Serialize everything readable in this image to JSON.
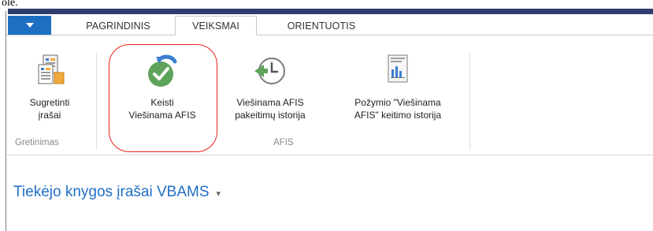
{
  "window": {
    "top_fragment": "ole."
  },
  "tabs": [
    {
      "label": "PAGRINDINIS",
      "active": false
    },
    {
      "label": "VEIKSMAI",
      "active": true
    },
    {
      "label": "ORIENTUOTIS",
      "active": false
    }
  ],
  "ribbon": {
    "groups": [
      {
        "label": "Gretinimas",
        "buttons": [
          {
            "label_line1": "Sugretinti",
            "label_line2": "įrašai",
            "icon": "compare-records-icon"
          }
        ]
      },
      {
        "label": "AFIS",
        "buttons": [
          {
            "label_line1": "Keisti",
            "label_line2": "Viešinama AFIS",
            "icon": "change-checkmark-icon"
          },
          {
            "label_line1": "Viešinama AFIS",
            "label_line2": "pakeitimų istorija",
            "icon": "history-clock-icon"
          },
          {
            "label_line1": "Požymio \"Viešinama",
            "label_line2": "AFIS\" keitimo istorija",
            "icon": "report-chart-icon"
          }
        ]
      }
    ]
  },
  "page": {
    "title": "Tiekėjo knygos įrašai VBAMS"
  },
  "colors": {
    "app_button": "#1d6fc2",
    "title_link": "#1f6ec7",
    "highlight_circle": "#e8221b",
    "check_green": "#5da35a"
  }
}
